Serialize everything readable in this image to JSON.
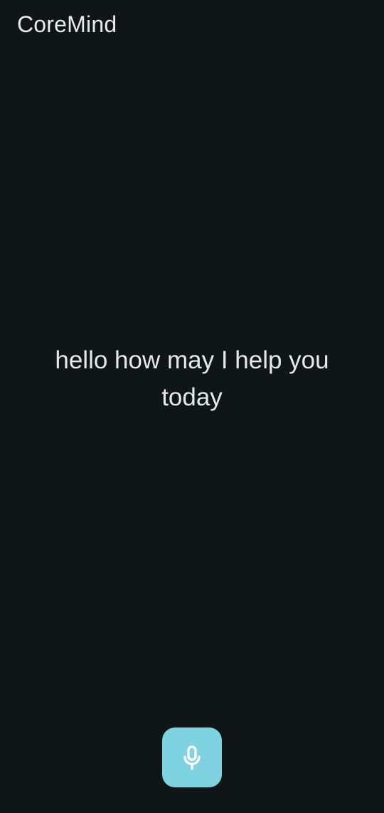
{
  "header": {
    "app_title": "CoreMind"
  },
  "main": {
    "greeting": "hello how may I help you today"
  },
  "controls": {
    "mic_button": {
      "icon": "microphone-icon",
      "accent_color": "#7fd3e0"
    }
  },
  "theme": {
    "background": "#101518",
    "text_color": "#e6e7e8"
  }
}
